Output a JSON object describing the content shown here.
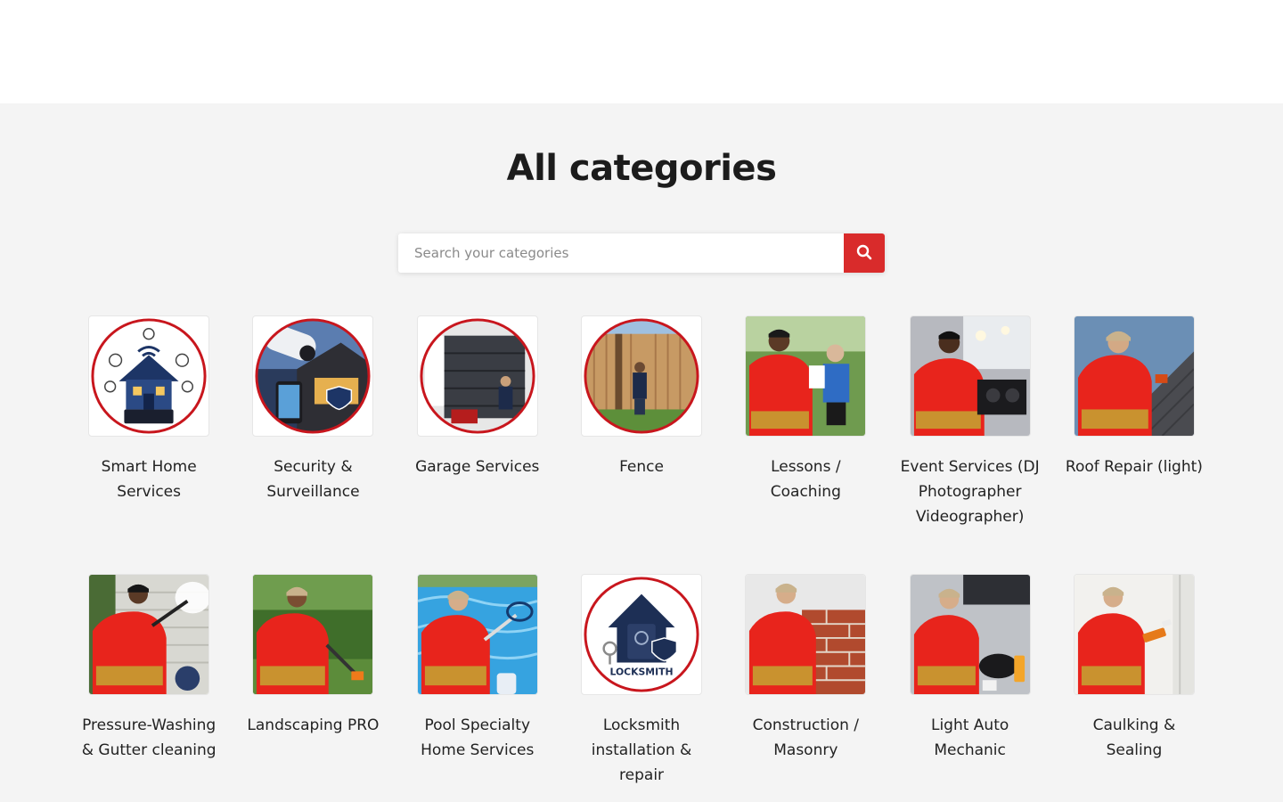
{
  "page": {
    "title": "All categories"
  },
  "search": {
    "placeholder": "Search your categories",
    "button_icon": "search-icon"
  },
  "colors": {
    "accent": "#d92b2b",
    "background": "#f4f4f4",
    "shirt_red": "#e8241c",
    "belt_tan": "#c9922f"
  },
  "categories": [
    {
      "label": "Smart Home Services",
      "icon": "smart-home-icon",
      "style": "circle"
    },
    {
      "label": "Security & Surveillance",
      "icon": "security-camera-icon",
      "style": "circle"
    },
    {
      "label": "Garage Services",
      "icon": "garage-door-icon",
      "style": "circle"
    },
    {
      "label": "Fence",
      "icon": "fence-icon",
      "style": "circle"
    },
    {
      "label": "Lessons / Coaching",
      "icon": "coaching-photo",
      "style": "photo"
    },
    {
      "label": "Event Services (DJ Photographer Videographer)",
      "icon": "dj-photo",
      "style": "photo"
    },
    {
      "label": "Roof Repair (light)",
      "icon": "roof-photo",
      "style": "photo"
    },
    {
      "label": "Pressure-Washing & Gutter cleaning",
      "icon": "pressure-washing-photo",
      "style": "photo"
    },
    {
      "label": "Landscaping PRO",
      "icon": "landscaping-photo",
      "style": "photo"
    },
    {
      "label": "Pool Specialty Home Services",
      "icon": "pool-photo",
      "style": "photo"
    },
    {
      "label": "Locksmith installation & repair",
      "icon": "locksmith-icon",
      "style": "circle",
      "badge_text": "LOCKSMITH"
    },
    {
      "label": "Construction / Masonry",
      "icon": "masonry-photo",
      "style": "photo"
    },
    {
      "label": "Light Auto Mechanic",
      "icon": "auto-mechanic-photo",
      "style": "photo"
    },
    {
      "label": "Caulking & Sealing",
      "icon": "caulking-photo",
      "style": "photo"
    }
  ]
}
